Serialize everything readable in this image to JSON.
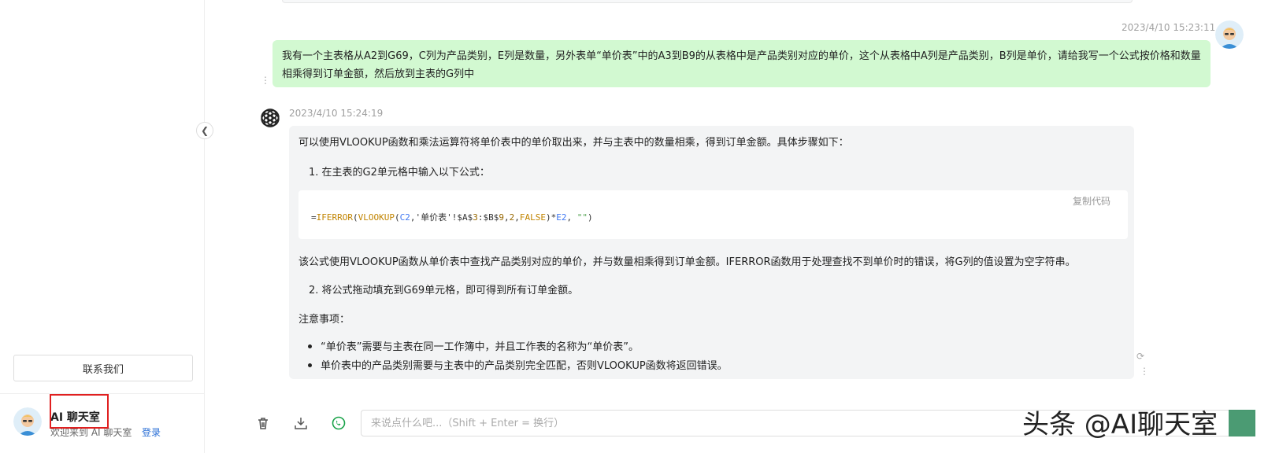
{
  "sidebar": {
    "contact_label": "联系我们",
    "user_title": "AI 聊天室",
    "user_welcome": "欢迎来到 AI 聊天室",
    "login_label": "登录"
  },
  "chat": {
    "user_message": {
      "timestamp": "2023/4/10 15:23:11",
      "text": "我有一个主表格从A2到G69，C列为产品类别，E列是数量，另外表单“单价表”中的A3到B9的从表格中是产品类别对应的单价，这个从表格中A列是产品类别，B列是单价，请给我写一个公式按价格和数量相乘得到订单金额，然后放到主表的G列中"
    },
    "bot_message": {
      "timestamp": "2023/4/10 15:24:19",
      "intro": "可以使用VLOOKUP函数和乘法运算符将单价表中的单价取出来，并与主表中的数量相乘，得到订单金额。具体步骤如下：",
      "step1": "1. 在主表的G2单元格中输入以下公式：",
      "code": {
        "p1": "=",
        "p2": "IFERROR",
        "p3": "(",
        "p4": "VLOOKUP",
        "p5": "(",
        "p6": "C2",
        "p7": ",'单价表'!$A$",
        "p8": "3",
        "p9": ":$B$",
        "p10": "9",
        "p11": ",",
        "p12": "2",
        "p13": ",",
        "p14": "FALSE",
        "p15": ")*",
        "p16": "E2",
        "p17": ", ",
        "p18": "\"\"",
        "p19": ")"
      },
      "copy_label": "复制代码",
      "description": "该公式使用VLOOKUP函数从单价表中查找产品类别对应的单价，并与数量相乘得到订单金额。IFERROR函数用于处理查找不到单价时的错误，将G列的值设置为空字符串。",
      "step2": "2. 将公式拖动填充到G69单元格，即可得到所有订单金额。",
      "notes_title": "注意事项：",
      "notes": [
        "“单价表”需要与主表在同一工作簿中，并且工作表的名称为“单价表”。",
        "单价表中的产品类别需要与主表中的产品类别完全匹配，否则VLOOKUP函数将返回错误。"
      ]
    }
  },
  "input": {
    "placeholder": "来说点什么吧...（Shift + Enter = 换行）"
  },
  "watermark": "头条 @AI聊天室",
  "colors": {
    "user_bubble": "#d2f9d1",
    "bot_bubble": "#f3f4f5",
    "highlight": "#e02020",
    "link": "#2a6fd6"
  },
  "icons": [
    "chevron-left-icon",
    "trash-icon",
    "download-icon",
    "share-icon",
    "refresh-icon",
    "more-icon",
    "openai-logo-icon"
  ]
}
